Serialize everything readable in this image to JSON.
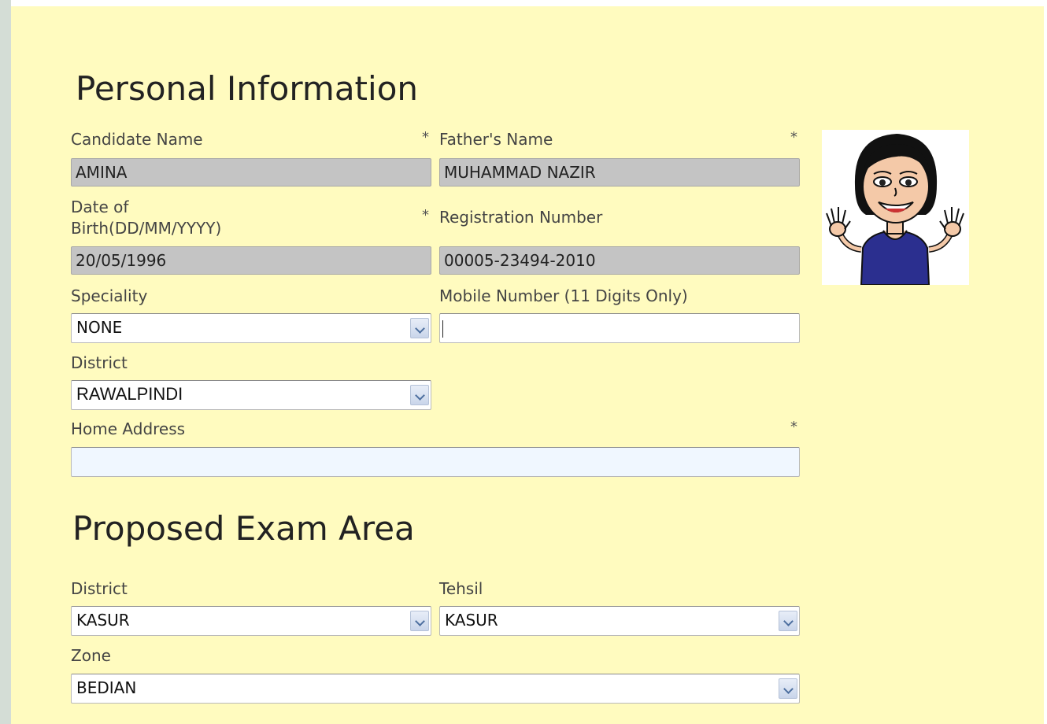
{
  "personal": {
    "title": "Personal Information",
    "required_mark": "*",
    "candidate_name": {
      "label": "Candidate Name",
      "value": "AMINA"
    },
    "father_name": {
      "label": "Father's Name",
      "value": "MUHAMMAD NAZIR"
    },
    "dob": {
      "label_line1": "Date of",
      "label_line2": "Birth(DD/MM/YYYY)",
      "value": "20/05/1996"
    },
    "registration": {
      "label": "Registration Number",
      "value": "00005-23494-2010"
    },
    "speciality": {
      "label": "Speciality",
      "value": "NONE"
    },
    "mobile": {
      "label": "Mobile Number (11 Digits Only)",
      "value": ""
    },
    "district": {
      "label": "District",
      "value": "RAWALPINDI"
    },
    "home_address": {
      "label": "Home Address",
      "value": ""
    }
  },
  "exam_area": {
    "title": "Proposed Exam Area",
    "district": {
      "label": "District",
      "value": "KASUR"
    },
    "tehsil": {
      "label": "Tehsil",
      "value": "KASUR"
    },
    "zone": {
      "label": "Zone",
      "value": "BEDIAN"
    }
  },
  "photo": {
    "icon": "candidate-photo-cartoon-woman"
  },
  "colors": {
    "panel_bg": "#fffbbf",
    "readonly_bg": "#c4c4c4",
    "address_bg": "#f0f7ff"
  }
}
